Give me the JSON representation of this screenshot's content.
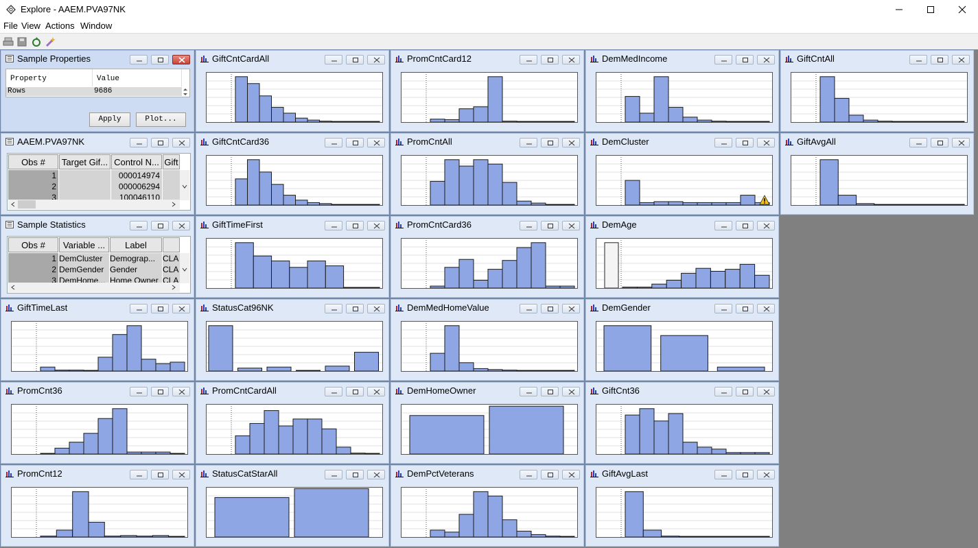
{
  "window": {
    "title": "Explore - AAEM.PVA97NK"
  },
  "menu": [
    "File",
    "View",
    "Actions",
    "Window"
  ],
  "toolbar": {
    "icons": [
      "print-icon",
      "save-icon",
      "refresh-icon",
      "wizard-icon"
    ]
  },
  "colors": {
    "bar_fill": "#8ea6e3",
    "bar_stroke": "#1a1a1a",
    "window_bg": "#dfe8f6",
    "workspace": "#808080"
  },
  "sample_properties": {
    "title": "Sample Properties",
    "col_property": "Property",
    "col_value": "Value",
    "row_property": "Rows",
    "row_value": "9686",
    "apply_label": "Apply",
    "plot_label": "Plot..."
  },
  "dataset": {
    "title": "AAEM.PVA97NK",
    "headers": [
      "Obs #",
      "Target Gif...",
      "Control N...",
      "Gift"
    ],
    "rows": [
      {
        "obs": "1",
        "control": "000014974"
      },
      {
        "obs": "2",
        "control": "000006294"
      },
      {
        "obs": "3",
        "control": "100046110"
      }
    ]
  },
  "sample_statistics": {
    "title": "Sample Statistics",
    "headers": [
      "Obs #",
      "Variable ...",
      "Label",
      ""
    ],
    "rows": [
      {
        "obs": "1",
        "variable": "DemCluster",
        "label": "Demograp...",
        "extra": "CLA"
      },
      {
        "obs": "2",
        "variable": "DemGender",
        "label": "Gender",
        "extra": "CLA"
      },
      {
        "obs": "3",
        "variable": "DemHome...",
        "label": "Home Owner",
        "extra": "CLA"
      }
    ]
  },
  "chart_data": [
    {
      "title": "GiftCntCardAll",
      "type": "bar",
      "values": [
        0.92,
        0.78,
        0.53,
        0.3,
        0.18,
        0.08,
        0.04,
        0.02,
        0.01,
        0.01,
        0.01,
        0.01
      ],
      "warning": false
    },
    {
      "title": "PromCntCard12",
      "type": "bar",
      "values": [
        0.06,
        0.05,
        0.27,
        0.31,
        0.92,
        0.02,
        0.01,
        0.01,
        0.01,
        0.01
      ],
      "warning": false
    },
    {
      "title": "DemMedIncome",
      "type": "bar",
      "values": [
        0.52,
        0.18,
        0.92,
        0.3,
        0.1,
        0.04,
        0.02,
        0.01,
        0.01,
        0.01
      ],
      "warning": false
    },
    {
      "title": "GiftCntAll",
      "type": "bar",
      "values": [
        0.92,
        0.48,
        0.14,
        0.04,
        0.02,
        0.01,
        0.01,
        0.01,
        0.01,
        0.01
      ],
      "warning": false
    },
    {
      "title": "GiftCntCard36",
      "type": "bar",
      "values": [
        0.53,
        0.92,
        0.67,
        0.42,
        0.2,
        0.1,
        0.05,
        0.03,
        0.01,
        0.01,
        0.01,
        0.01
      ],
      "warning": false
    },
    {
      "title": "PromCntAll",
      "type": "bar",
      "values": [
        0.48,
        0.92,
        0.79,
        0.92,
        0.83,
        0.46,
        0.08,
        0.04,
        0.01,
        0.01
      ],
      "warning": false
    },
    {
      "title": "DemCluster",
      "type": "bar",
      "values": [
        0.5,
        0.05,
        0.07,
        0.07,
        0.05,
        0.05,
        0.05,
        0.05,
        0.2,
        0.05
      ],
      "warning": true
    },
    {
      "title": "GiftAvgAll",
      "type": "bar",
      "values": [
        0.92,
        0.2,
        0.03,
        0.01,
        0.01,
        0.01,
        0.01,
        0.01
      ],
      "warning": false
    },
    {
      "title": "GiftTimeFirst",
      "type": "bar",
      "values": [
        0.92,
        0.65,
        0.55,
        0.42,
        0.55,
        0.45,
        0.01,
        0.01
      ],
      "warning": false
    },
    {
      "title": "PromCntCard36",
      "type": "bar",
      "values": [
        0.04,
        0.42,
        0.58,
        0.16,
        0.38,
        0.56,
        0.82,
        0.92,
        0.04,
        0.04
      ],
      "warning": false
    },
    {
      "title": "DemAge",
      "type": "bar",
      "values": [
        0.02,
        0.02,
        0.08,
        0.16,
        0.3,
        0.4,
        0.34,
        0.38,
        0.48,
        0.26
      ],
      "warning": false,
      "missing_bar": 0.92
    },
    {
      "title": "GiftTimeLast",
      "type": "bar",
      "values": [
        0.08,
        0.02,
        0.02,
        0.01,
        0.28,
        0.74,
        0.92,
        0.24,
        0.15,
        0.18
      ],
      "warning": false
    },
    {
      "title": "StatusCat96NK",
      "type": "bar",
      "values": [
        0.92,
        0.06,
        0.08,
        0.01,
        0.1,
        0.38
      ],
      "warning": false
    },
    {
      "title": "DemMedHomeValue",
      "type": "bar",
      "values": [
        0.36,
        0.92,
        0.17,
        0.05,
        0.03,
        0.02,
        0.01,
        0.01,
        0.01,
        0.01
      ],
      "warning": false
    },
    {
      "title": "DemGender",
      "type": "bar",
      "values": [
        0.92,
        0.72,
        0.08
      ],
      "warning": false
    },
    {
      "title": "PromCnt36",
      "type": "bar",
      "values": [
        0.01,
        0.12,
        0.24,
        0.42,
        0.72,
        0.92,
        0.04,
        0.04,
        0.04,
        0.01
      ],
      "warning": false
    },
    {
      "title": "PromCntCardAll",
      "type": "bar",
      "values": [
        0.37,
        0.62,
        0.88,
        0.57,
        0.71,
        0.71,
        0.51,
        0.14,
        0.02,
        0.01
      ],
      "warning": false
    },
    {
      "title": "DemHomeOwner",
      "type": "bar",
      "values": [
        0.78,
        0.97
      ],
      "warning": false
    },
    {
      "title": "GiftCnt36",
      "type": "bar",
      "values": [
        0.79,
        0.92,
        0.67,
        0.82,
        0.24,
        0.14,
        0.1,
        0.03,
        0.03,
        0.03
      ],
      "warning": false
    },
    {
      "title": "PromCnt12",
      "type": "bar",
      "values": [
        0.02,
        0.14,
        0.92,
        0.3,
        0.02,
        0.03,
        0.02,
        0.03,
        0.01
      ],
      "warning": false
    },
    {
      "title": "StatusCatStarAll",
      "type": "bar",
      "values": [
        0.8,
        0.98
      ],
      "warning": false
    },
    {
      "title": "DemPctVeterans",
      "type": "bar",
      "values": [
        0.14,
        0.1,
        0.46,
        0.92,
        0.83,
        0.35,
        0.12,
        0.05,
        0.02,
        0.01
      ],
      "warning": false
    },
    {
      "title": "GiftAvgLast",
      "type": "bar",
      "values": [
        0.92,
        0.14,
        0.02,
        0.01,
        0.01,
        0.01,
        0.01,
        0.01
      ],
      "warning": false
    }
  ]
}
